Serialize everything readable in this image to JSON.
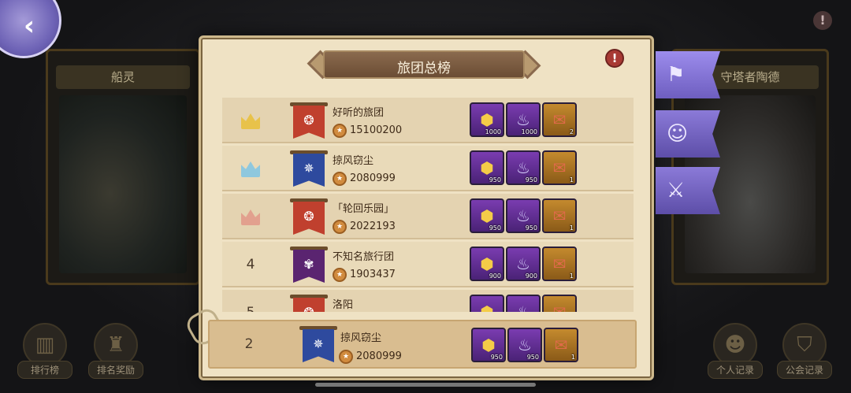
{
  "background": {
    "left_panel_title": "船灵",
    "right_panel_title": "守塔者陶德",
    "bottom_buttons": [
      {
        "label": "排行榜",
        "icon": "chart-icon"
      },
      {
        "label": "排名奖励",
        "icon": "castle-icon"
      },
      {
        "label": "个人记录",
        "icon": "person-icon"
      },
      {
        "label": "公会记录",
        "icon": "shield-icon"
      }
    ]
  },
  "dialog": {
    "title": "旅团总榜",
    "info_glyph": "!"
  },
  "rows": [
    {
      "rank": "1",
      "crown": "gold",
      "flag_color": "red",
      "flag_glyph": "❂",
      "name": "好听的旅团",
      "power": "15100200",
      "rewards": [
        {
          "type": "coin",
          "qty": "1000"
        },
        {
          "type": "lamp",
          "qty": "1000"
        },
        {
          "type": "scroll",
          "qty": "2"
        }
      ]
    },
    {
      "rank": "2",
      "crown": "silver",
      "flag_color": "blue",
      "flag_glyph": "✵",
      "name": "掠风窃尘",
      "power": "2080999",
      "rewards": [
        {
          "type": "coin",
          "qty": "950"
        },
        {
          "type": "lamp",
          "qty": "950"
        },
        {
          "type": "scroll",
          "qty": "1"
        }
      ]
    },
    {
      "rank": "3",
      "crown": "bronze",
      "flag_color": "red",
      "flag_glyph": "❂",
      "name": "「轮回乐园」",
      "power": "2022193",
      "rewards": [
        {
          "type": "coin",
          "qty": "950"
        },
        {
          "type": "lamp",
          "qty": "950"
        },
        {
          "type": "scroll",
          "qty": "1"
        }
      ]
    },
    {
      "rank": "4",
      "crown": "",
      "flag_color": "purple",
      "flag_glyph": "✾",
      "name": "不知名旅行团",
      "power": "1903437",
      "rewards": [
        {
          "type": "coin",
          "qty": "900"
        },
        {
          "type": "lamp",
          "qty": "900"
        },
        {
          "type": "scroll",
          "qty": "1"
        }
      ]
    },
    {
      "rank": "5",
      "crown": "",
      "flag_color": "red",
      "flag_glyph": "❂",
      "name": "洛阳",
      "power": "",
      "rewards": [
        {
          "type": "coin",
          "qty": ""
        },
        {
          "type": "lamp",
          "qty": ""
        },
        {
          "type": "scroll",
          "qty": ""
        }
      ]
    }
  ],
  "own_row": {
    "rank": "2",
    "flag_color": "blue",
    "flag_glyph": "✵",
    "name": "掠风窃尘",
    "power": "2080999",
    "rewards": [
      {
        "type": "coin",
        "qty": "950"
      },
      {
        "type": "lamp",
        "qty": "950"
      },
      {
        "type": "scroll",
        "qty": "1"
      }
    ]
  },
  "side_tabs": [
    {
      "icon": "banner-tab-icon",
      "glyph": "⚑"
    },
    {
      "icon": "character-tab-icon",
      "glyph": "☺"
    },
    {
      "icon": "swords-tab-icon",
      "glyph": "⚔"
    }
  ],
  "colors": {
    "accent": "#6e5ec0",
    "parchment": "#efe2c4"
  }
}
